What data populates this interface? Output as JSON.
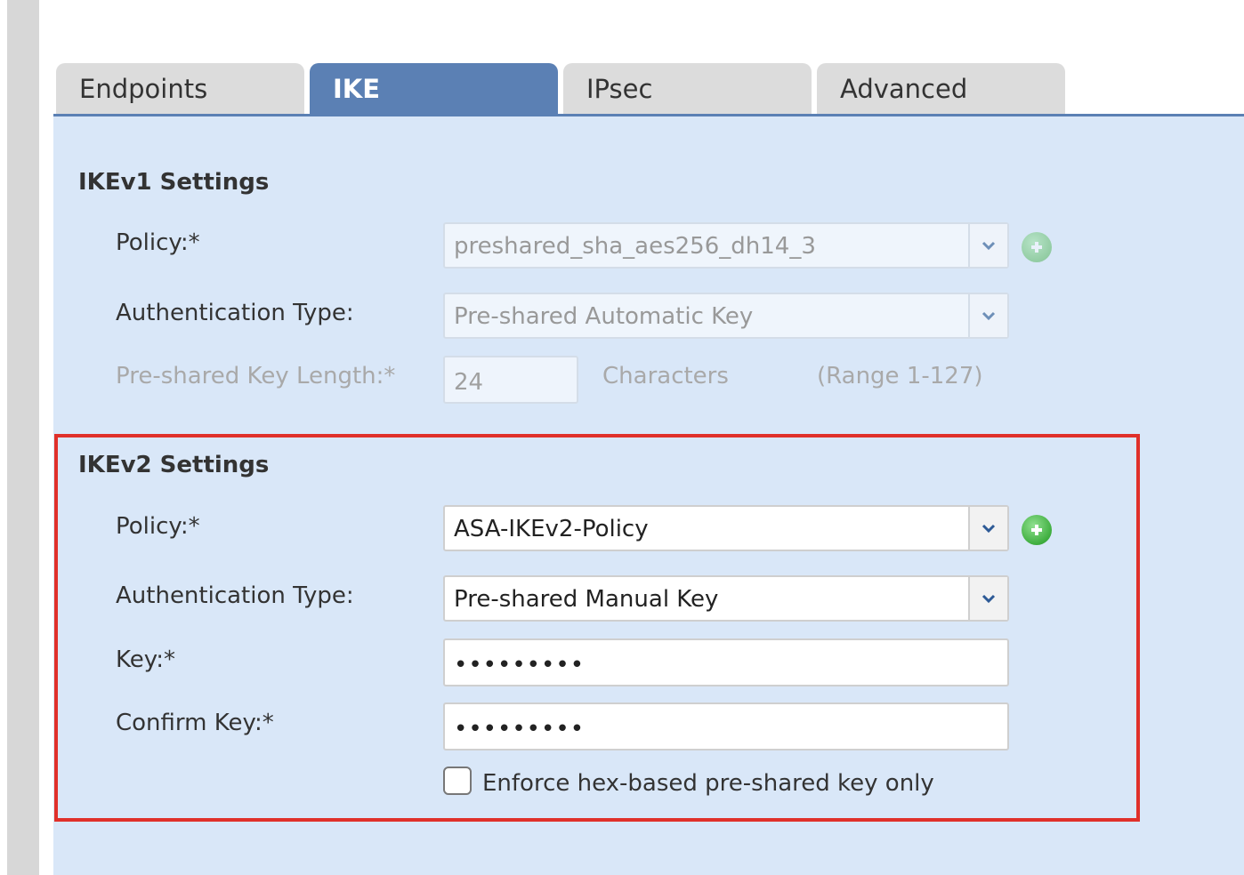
{
  "tabs": [
    {
      "label": "Endpoints"
    },
    {
      "label": "IKE"
    },
    {
      "label": "IPsec"
    },
    {
      "label": "Advanced"
    }
  ],
  "active_tab": "IKE",
  "ikev1": {
    "title": "IKEv1 Settings",
    "policy_label": "Policy:*",
    "policy_value": "preshared_sha_aes256_dh14_3",
    "auth_type_label": "Authentication Type:",
    "auth_type_value": "Pre-shared Automatic Key",
    "key_length_label": "Pre-shared Key Length:*",
    "key_length_value": "24",
    "key_length_unit": "Characters",
    "key_length_range": "(Range 1-127)"
  },
  "ikev2": {
    "title": "IKEv2 Settings",
    "policy_label": "Policy:*",
    "policy_value": "ASA-IKEv2-Policy",
    "auth_type_label": "Authentication Type:",
    "auth_type_value": "Pre-shared Manual Key",
    "key_label": "Key:*",
    "key_value": "•••••••••",
    "confirm_key_label": "Confirm Key:*",
    "confirm_key_value": "•••••••••",
    "enforce_hex_label": "Enforce hex-based pre-shared key only",
    "enforce_hex_checked": false
  },
  "colors": {
    "active_tab": "#5b80b4",
    "panel_bg": "#d9e7f8",
    "highlight_border": "#e0302a",
    "add_icon": "#3fae3f"
  },
  "icons": {
    "dropdown": "chevron-down-icon",
    "add": "plus-circle-icon"
  }
}
